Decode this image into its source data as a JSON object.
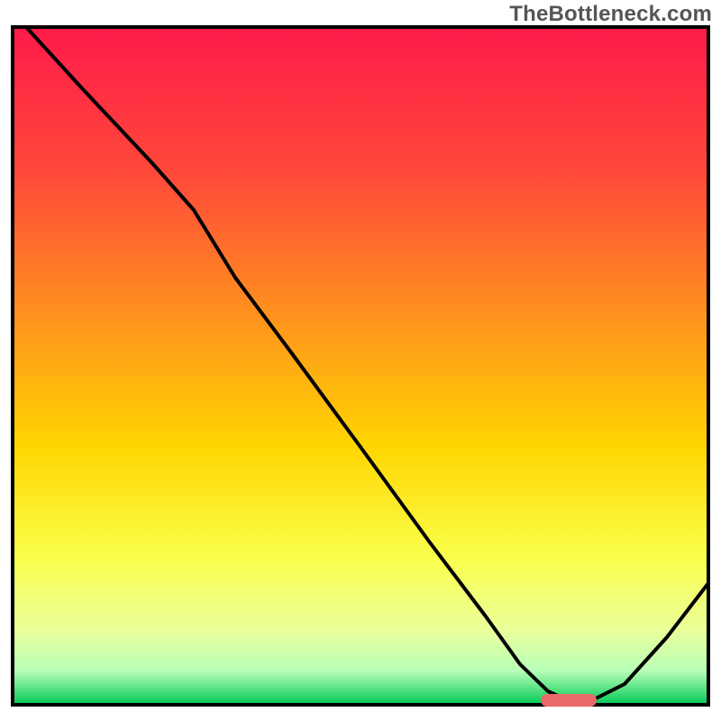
{
  "watermark": "TheBottleneck.com",
  "chart_data": {
    "type": "line",
    "title": "",
    "xlabel": "",
    "ylabel": "",
    "xlim": [
      0,
      100
    ],
    "ylim": [
      0,
      100
    ],
    "x": [
      2,
      10,
      20,
      26,
      32,
      40,
      50,
      60,
      68,
      73,
      77,
      80,
      83,
      88,
      94,
      100
    ],
    "values": [
      100,
      91,
      80,
      73,
      63,
      52,
      38,
      24,
      13,
      6,
      2,
      0.5,
      0.5,
      3,
      10,
      18
    ],
    "annotations": [
      {
        "type": "marker",
        "x_range": [
          77,
          83
        ],
        "y": 0.6,
        "color": "#e96a6a",
        "note": "optimal-range"
      }
    ],
    "background_gradient": {
      "top_color": "#ff1a4a",
      "mid_colors": [
        "#ff8a2a",
        "#ffd600",
        "#f7ff7a"
      ],
      "bottom_color": "#00c853"
    }
  }
}
